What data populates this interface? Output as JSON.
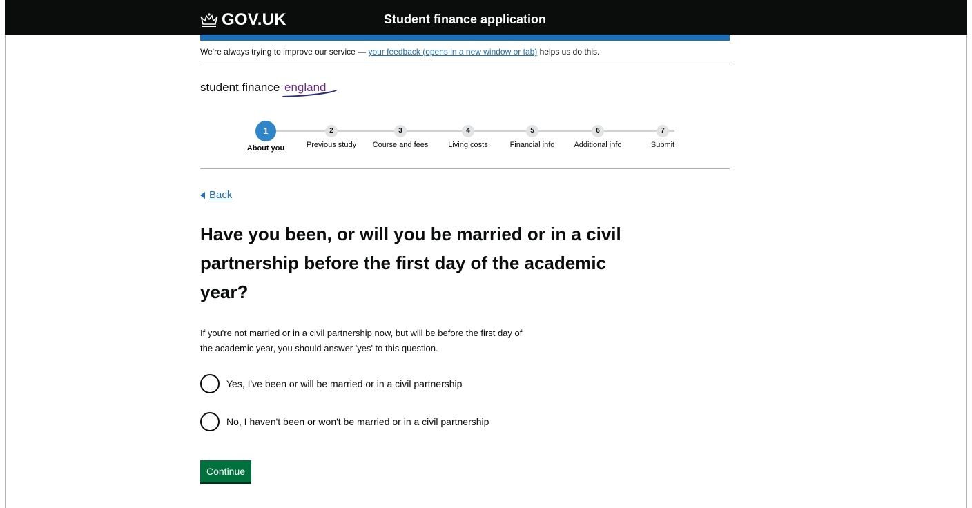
{
  "header": {
    "logo_text": "GOV.UK",
    "service_name": "Student finance application"
  },
  "feedback": {
    "prefix": "We're always trying to improve our service — ",
    "link": "your feedback (opens in a new window or tab)",
    "suffix": " helps us do this."
  },
  "brand": {
    "word1": "student finance",
    "word2": "england",
    "color1": "#0b0c0c",
    "color2": "#6f2c91"
  },
  "progress": {
    "current_step": 1,
    "steps": [
      {
        "number": "1",
        "label": "About you"
      },
      {
        "number": "2",
        "label": "Previous study"
      },
      {
        "number": "3",
        "label": "Course and fees"
      },
      {
        "number": "4",
        "label": "Living costs"
      },
      {
        "number": "5",
        "label": "Financial info"
      },
      {
        "number": "6",
        "label": "Additional info"
      },
      {
        "number": "7",
        "label": "Submit"
      }
    ]
  },
  "nav": {
    "back_label": "Back"
  },
  "question": {
    "title": "Have you been, or will you be married or in a civil partnership before the first day of the academic year?",
    "hint_line1": "If you're not married or in a civil partnership now, but will be before the first day of",
    "hint_line2": "the academic year, you should answer 'yes' to this question.",
    "options": [
      {
        "label": "Yes, I've been or will be married or in a civil partnership",
        "selected": false
      },
      {
        "label": "No, I haven't been or won't be married or in a civil partnership",
        "selected": false
      }
    ]
  },
  "actions": {
    "continue_label": "Continue"
  },
  "colors": {
    "link": "#1d70b8",
    "active_step": "#2e86c9",
    "button": "#00703c",
    "header_bg": "#0b0c0c"
  }
}
